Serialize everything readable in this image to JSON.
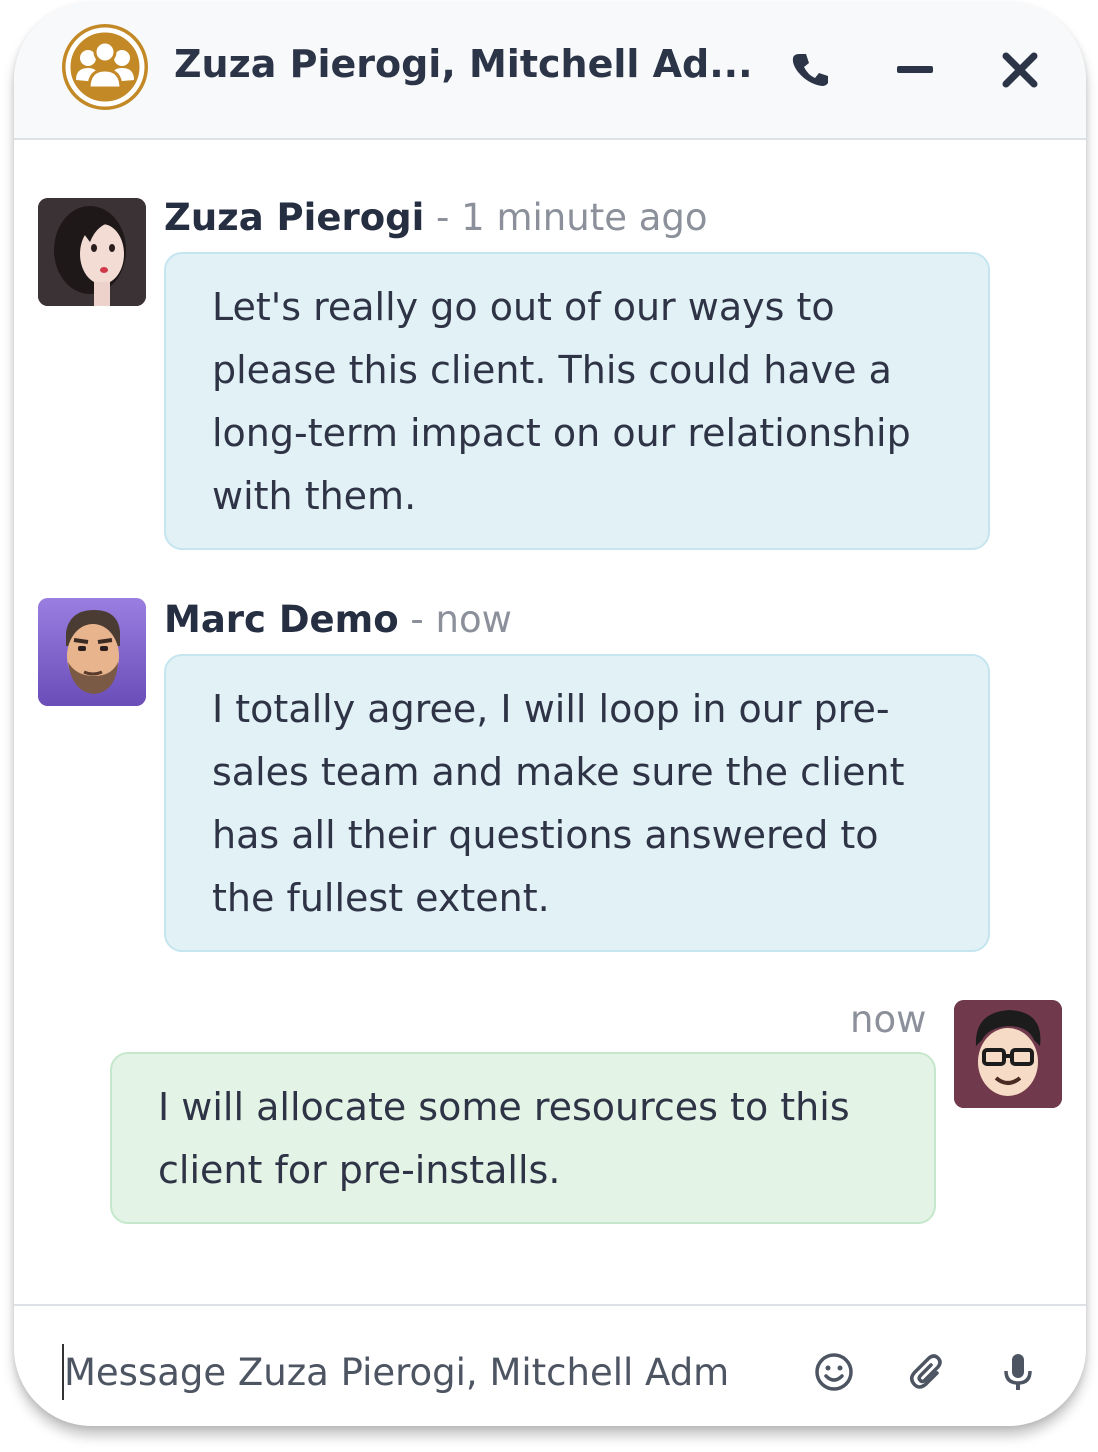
{
  "header": {
    "title": "Zuza Pierogi, Mitchell Ad...",
    "group_icon": "group-users-icon",
    "actions": [
      {
        "name": "call",
        "icon": "phone-icon"
      },
      {
        "name": "minimize",
        "icon": "minus-icon"
      },
      {
        "name": "close",
        "icon": "close-icon"
      }
    ]
  },
  "messages": [
    {
      "author": "Zuza Pierogi",
      "separator": " - ",
      "time": "1 minute ago",
      "lines": [
        "Let's really go out of our ways to",
        "please this client. This could have a",
        "long-term impact on our relationship",
        "with them."
      ]
    },
    {
      "author": "Marc Demo",
      "separator": " - ",
      "time": "now",
      "lines": [
        "I totally agree, I will loop in our pre-",
        "sales team and make sure the client",
        "has all their questions answered to",
        "the fullest extent."
      ]
    },
    {
      "time": "now",
      "self": true,
      "lines": [
        "I will allocate some resources to this",
        "client for pre-installs."
      ]
    }
  ],
  "composer": {
    "placeholder": "Message Zuza Pierogi, Mitchell Adm",
    "actions": [
      {
        "name": "emoji",
        "icon": "smiley-icon"
      },
      {
        "name": "attach",
        "icon": "paperclip-icon"
      },
      {
        "name": "voice",
        "icon": "microphone-icon"
      }
    ]
  },
  "colors": {
    "accent": "#c38926",
    "received_bubble": "#e1f1f6",
    "sent_bubble": "#e3f3e6",
    "header_bg": "#f8f9fa"
  }
}
